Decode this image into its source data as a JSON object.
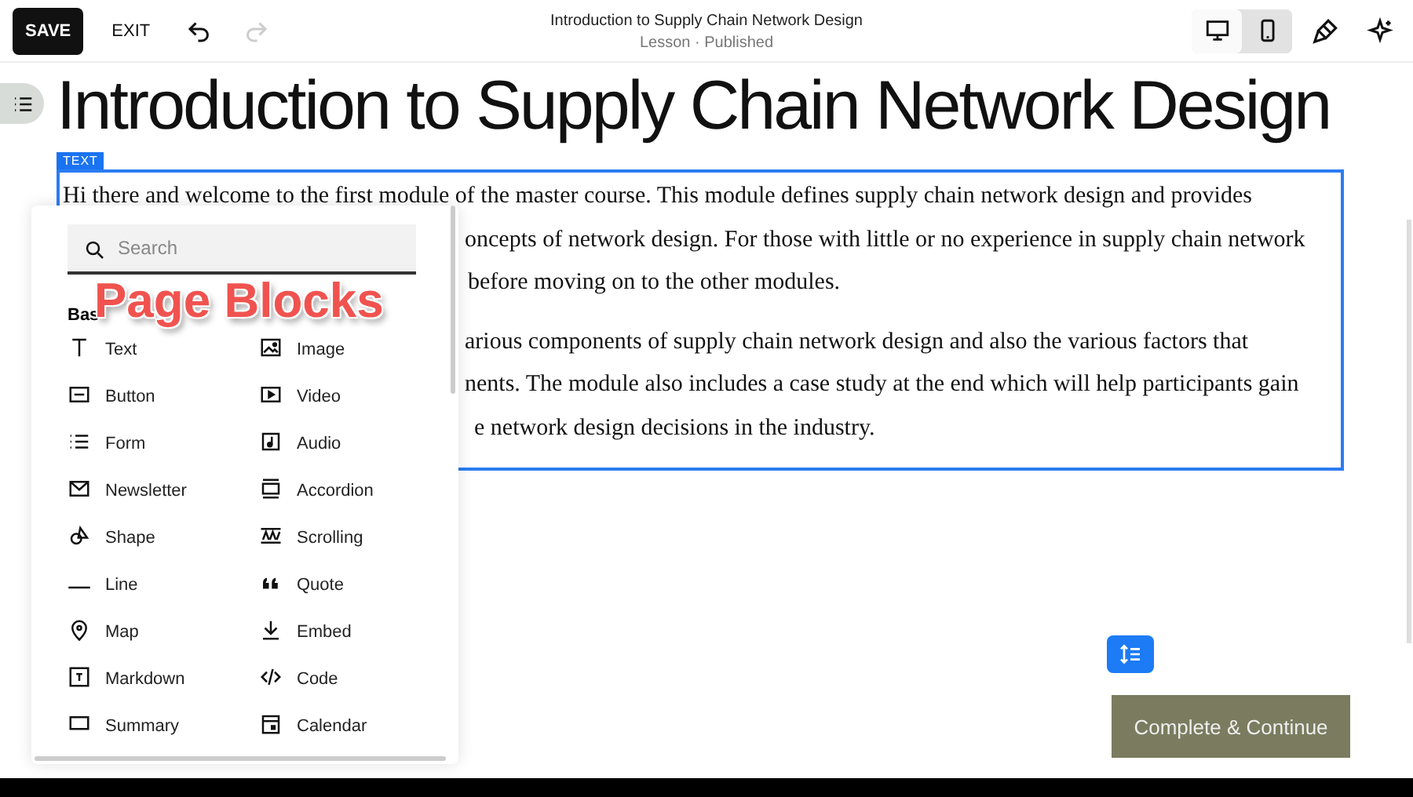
{
  "toolbar": {
    "save": "SAVE",
    "exit": "EXIT",
    "undo": {
      "disabled": false
    },
    "redo": {
      "disabled": true
    },
    "title": "Introduction to Supply Chain Network Design",
    "subtitle": "Lesson · Published",
    "views": [
      {
        "kind": "desktop",
        "selected": true
      },
      {
        "kind": "mobile",
        "selected": false
      }
    ]
  },
  "page": {
    "heading": "Introduction to Supply Chain Network Design",
    "block_tag": "TEXT",
    "lines": [
      "Hi there and welcome to the first module of the master course. This module defines supply chain network design and provides",
      "oncepts of network design. For those with little or no experience in supply chain network",
      "before moving on to the other modules.",
      "arious components of supply chain network design and also the various factors that",
      "nents. The module also includes a case study at the end which will help participants gain",
      "e network design decisions in the industry."
    ],
    "complete_button": "Complete & Continue"
  },
  "blocks_panel": {
    "search": {
      "placeholder": "Search"
    },
    "section": "Bas",
    "items": [
      "Text",
      "Image",
      "Button",
      "Video",
      "Form",
      "Audio",
      "Newsletter",
      "Accordion",
      "Shape",
      "Scrolling",
      "Line",
      "Quote",
      "Map",
      "Embed",
      "Markdown",
      "Code",
      "Summary",
      "Calendar"
    ]
  },
  "annotation": "Page Blocks"
}
